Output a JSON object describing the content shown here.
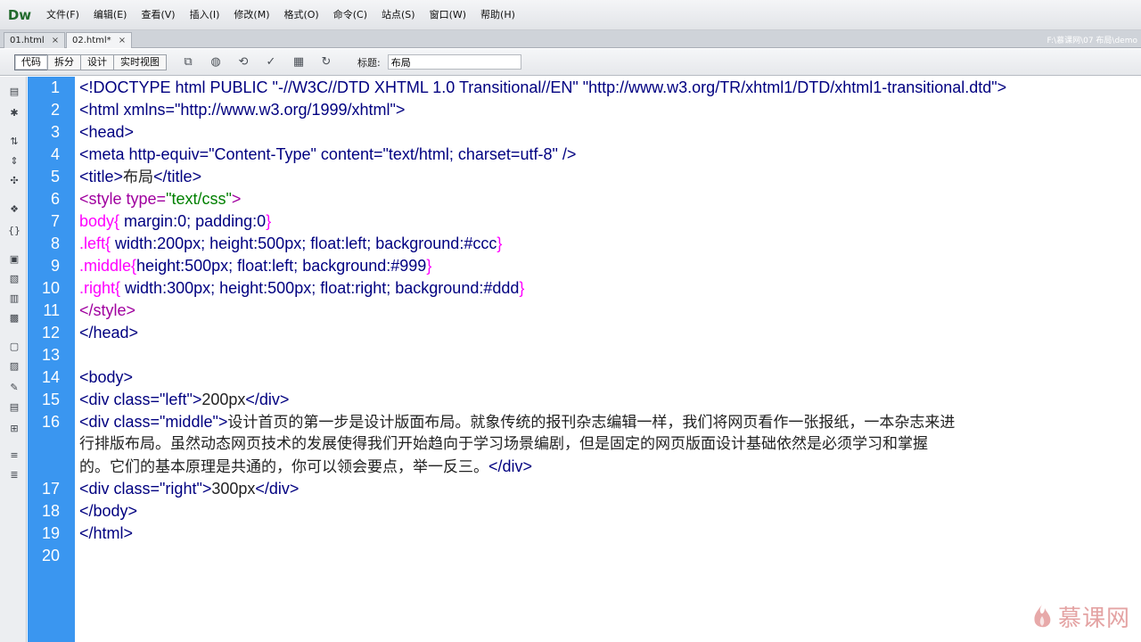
{
  "app": {
    "logo": "Dw"
  },
  "menu": [
    "文件(F)",
    "编辑(E)",
    "查看(V)",
    "插入(I)",
    "修改(M)",
    "格式(O)",
    "命令(C)",
    "站点(S)",
    "窗口(W)",
    "帮助(H)"
  ],
  "tabs": [
    {
      "label": "01.html",
      "close": "×"
    },
    {
      "label": "02.html*",
      "close": "×"
    }
  ],
  "file_path": "F:\\慕课网\\07 布局\\demo",
  "toolbar": {
    "views": [
      "代码",
      "拆分",
      "设计",
      "实时视图"
    ],
    "title_label": "标题:",
    "title_value": "布局",
    "icons": [
      "file-management-icon",
      "preview-browser-icon",
      "refresh-design-icon",
      "validate-icon",
      "visual-aids-icon",
      "refresh-icon"
    ]
  },
  "coding_toolbar_icons": [
    "open-documents-icon",
    "collapse-tag-icon",
    "collapse-selection-icon",
    "expand-all-icon",
    "select-parent-tag-icon",
    "balance-braces-icon",
    "line-numbers-icon",
    "highlight-invalid-icon",
    "word-wrap-icon",
    "syntax-coloring-icon",
    "apply-comment-icon",
    "remove-comment-icon",
    "wrap-tag-icon",
    "recent-snippets-icon",
    "move-css-icon",
    "indent-icon",
    "outdent-icon",
    "format-source-icon"
  ],
  "code": {
    "line_numbers": [
      "1",
      "2",
      "3",
      "4",
      "5",
      "6",
      "7",
      "8",
      "9",
      "10",
      "11",
      "12",
      "13",
      "14",
      "15",
      "16",
      "17",
      "18",
      "19",
      "20"
    ],
    "l1": "<!DOCTYPE html PUBLIC \"-//W3C//DTD XHTML 1.0 Transitional//EN\" \"http://www.w3.org/TR/xhtml1/DTD/xhtml1-transitional.dtd\">",
    "l2": "<html xmlns=\"http://www.w3.org/1999/xhtml\">",
    "l3": "<head>",
    "l4": "<meta http-equiv=\"Content-Type\" content=\"text/html; charset=utf-8\" />",
    "l5_open": "<title>",
    "l5_text": "布局",
    "l5_close": "</title>",
    "l6_tag": "<style type=",
    "l6_val": "\"text/css\"",
    "l6_end": ">",
    "l7_sel": "body{ ",
    "l7_p1": "margin",
    "l7_v1": ":0; ",
    "l7_p2": "padding",
    "l7_v2": ":0",
    "l7_end": "}",
    "l8_sel": ".left{ ",
    "l8_p1": "width",
    "l8_v1": ":200px; ",
    "l8_p2": "height",
    "l8_v2": ":500px; ",
    "l8_p3": "float",
    "l8_v3": ":left; ",
    "l8_p4": "background",
    "l8_v4": ":#ccc",
    "l8_end": "}",
    "l9_sel": ".middle{",
    "l9_p1": "height",
    "l9_v1": ":500px; ",
    "l9_p2": "float",
    "l9_v2": ":left; ",
    "l9_p3": "background",
    "l9_v3": ":#999",
    "l9_end": "}",
    "l10_sel": ".right{ ",
    "l10_p1": "width",
    "l10_v1": ":300px; ",
    "l10_p2": "height",
    "l10_v2": ":500px; ",
    "l10_p3": "float",
    "l10_v3": ":right; ",
    "l10_p4": "background",
    "l10_v4": ":#ddd",
    "l10_end": "}",
    "l11": "</style>",
    "l12": "</head>",
    "l14": "<body>",
    "l15_open": "<div class=",
    "l15_val": "\"left\"",
    "l15_gt": ">",
    "l15_text": "200px",
    "l15_close": "</div>",
    "l16_open": "<div class=",
    "l16_val": "\"middle\"",
    "l16_gt": ">",
    "l16_text1": "设计首页的第一步是设计版面布局。就象传统的报刊杂志编辑一样，我们将网页看作一张报纸，一本杂志来进",
    "l16_text2": "行排版布局。虽然动态网页技术的发展使得我们开始趋向于学习场景编剧，但是固定的网页版面设计基础依然是必须学习和掌握",
    "l16_text3": "的。它们的基本原理是共通的，你可以领会要点，举一反三。",
    "l16_close": "</div>",
    "l17_open": "<div class=",
    "l17_val": "\"right\"",
    "l17_gt": ">",
    "l17_text": "300px",
    "l17_close": "</div>",
    "l18": "</body>",
    "l19": "</html>"
  },
  "watermark": "慕课网"
}
